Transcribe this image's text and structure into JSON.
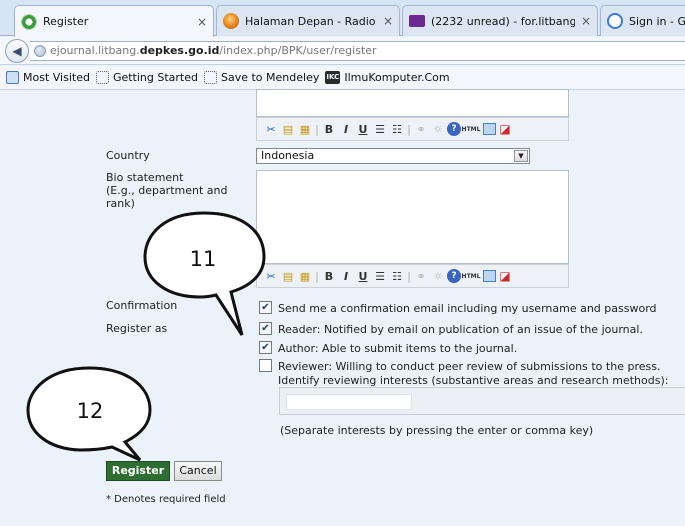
{
  "browser": {
    "tabs": [
      {
        "title": "Register",
        "active": true
      },
      {
        "title": "Halaman Depan - Radio Ro...",
        "active": false
      },
      {
        "title": "(2232 unread) - for.litbang ...",
        "active": false
      },
      {
        "title": "Sign in - Go",
        "active": false
      }
    ],
    "tab_close_glyph": "×",
    "url": {
      "prefix": "ejournal.litbang.",
      "domain": "depkes.go.id",
      "path": "/index.php/BPK/user/register"
    },
    "bookmarks": [
      "Most Visited",
      "Getting Started",
      "Save to Mendeley",
      "IlmuKomputer.Com"
    ],
    "ikc_badge": "IKC"
  },
  "toolbar": {
    "buttons": [
      {
        "name": "cut-icon",
        "glyph": "✂",
        "cls": "cut"
      },
      {
        "name": "copy-icon",
        "glyph": "▤",
        "cls": "copy"
      },
      {
        "name": "paste-icon",
        "glyph": "▦",
        "cls": "paste"
      },
      {
        "name": "separator",
        "glyph": "|",
        "cls": "sep"
      },
      {
        "name": "bold-icon",
        "glyph": "B",
        "cls": "bold"
      },
      {
        "name": "italic-icon",
        "glyph": "I",
        "cls": "italic"
      },
      {
        "name": "underline-icon",
        "glyph": "U",
        "cls": "underline"
      },
      {
        "name": "bullet-list-icon",
        "glyph": "☰",
        "cls": "list"
      },
      {
        "name": "numbered-list-icon",
        "glyph": "☷",
        "cls": "list"
      },
      {
        "name": "separator",
        "glyph": "|",
        "cls": "sep"
      },
      {
        "name": "link-icon",
        "glyph": "⚭",
        "cls": "link"
      },
      {
        "name": "unlink-icon",
        "glyph": "☼",
        "cls": "unlink"
      },
      {
        "name": "help-icon",
        "glyph": "?",
        "cls": "help"
      },
      {
        "name": "html-icon",
        "glyph": "HTML",
        "cls": "html"
      },
      {
        "name": "image-icon",
        "glyph": "",
        "cls": "img"
      },
      {
        "name": "fullscreen-icon",
        "glyph": "◪",
        "cls": "full"
      }
    ]
  },
  "form": {
    "country_label": "Country",
    "country_value": "Indonesia",
    "bio_label": "Bio statement\n(E.g., department and\nrank)",
    "confirmation_label": "Confirmation",
    "confirmation_option": "Send me a confirmation email including my username and password",
    "register_as_label": "Register as",
    "reader_option": "Reader: Notified by email on publication of an issue of the journal.",
    "author_option": "Author: Able to submit items to the journal.",
    "reviewer_option_line1": "Reviewer: Willing to conduct peer review of submissions to the press.",
    "reviewer_option_line2": "Identify reviewing interests (substantive areas and research methods):",
    "interests_note": "(Separate interests by pressing the enter or comma key)",
    "register_button": "Register",
    "cancel_button": "Cancel",
    "required_note": "* Denotes required field",
    "checked_glyph": "✔"
  },
  "callouts": [
    {
      "label": "11"
    },
    {
      "label": "12"
    }
  ]
}
